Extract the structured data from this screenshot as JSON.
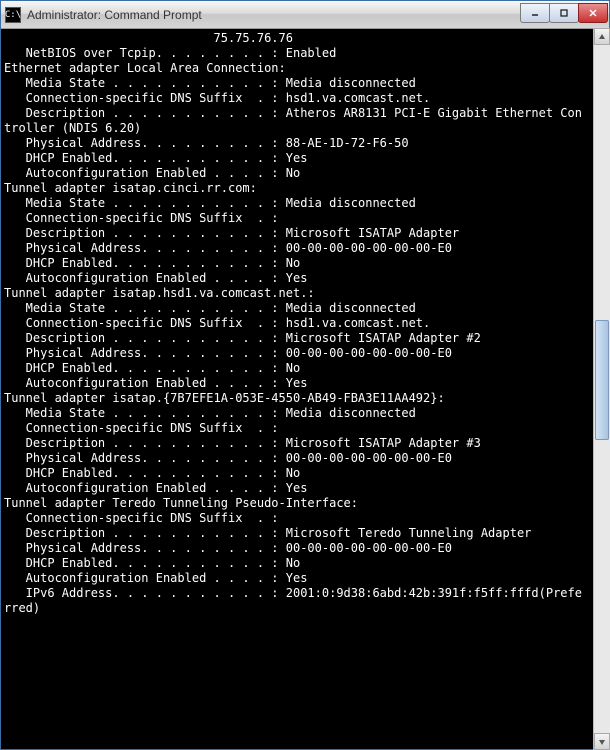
{
  "window": {
    "title": "Administrator: Command Prompt",
    "sysicon_label": "C:\\"
  },
  "lines": [
    "                             75.75.76.76",
    "   NetBIOS over Tcpip. . . . . . . . : Enabled",
    "",
    "Ethernet adapter Local Area Connection:",
    "",
    "   Media State . . . . . . . . . . . : Media disconnected",
    "   Connection-specific DNS Suffix  . : hsd1.va.comcast.net.",
    "   Description . . . . . . . . . . . : Atheros AR8131 PCI-E Gigabit Ethernet Con",
    "troller (NDIS 6.20)",
    "   Physical Address. . . . . . . . . : 88-AE-1D-72-F6-50",
    "   DHCP Enabled. . . . . . . . . . . : Yes",
    "   Autoconfiguration Enabled . . . . : No",
    "",
    "Tunnel adapter isatap.cinci.rr.com:",
    "",
    "   Media State . . . . . . . . . . . : Media disconnected",
    "   Connection-specific DNS Suffix  . :",
    "   Description . . . . . . . . . . . : Microsoft ISATAP Adapter",
    "   Physical Address. . . . . . . . . : 00-00-00-00-00-00-00-E0",
    "   DHCP Enabled. . . . . . . . . . . : No",
    "   Autoconfiguration Enabled . . . . : Yes",
    "",
    "Tunnel adapter isatap.hsd1.va.comcast.net.:",
    "",
    "   Media State . . . . . . . . . . . : Media disconnected",
    "   Connection-specific DNS Suffix  . : hsd1.va.comcast.net.",
    "   Description . . . . . . . . . . . : Microsoft ISATAP Adapter #2",
    "   Physical Address. . . . . . . . . : 00-00-00-00-00-00-00-E0",
    "   DHCP Enabled. . . . . . . . . . . : No",
    "   Autoconfiguration Enabled . . . . : Yes",
    "",
    "Tunnel adapter isatap.{7B7EFE1A-053E-4550-AB49-FBA3E11AA492}:",
    "",
    "   Media State . . . . . . . . . . . : Media disconnected",
    "   Connection-specific DNS Suffix  . :",
    "   Description . . . . . . . . . . . : Microsoft ISATAP Adapter #3",
    "   Physical Address. . . . . . . . . : 00-00-00-00-00-00-00-E0",
    "   DHCP Enabled. . . . . . . . . . . : No",
    "   Autoconfiguration Enabled . . . . : Yes",
    "",
    "Tunnel adapter Teredo Tunneling Pseudo-Interface:",
    "",
    "   Connection-specific DNS Suffix  . :",
    "   Description . . . . . . . . . . . : Microsoft Teredo Tunneling Adapter",
    "   Physical Address. . . . . . . . . : 00-00-00-00-00-00-00-E0",
    "   DHCP Enabled. . . . . . . . . . . : No",
    "   Autoconfiguration Enabled . . . . : Yes",
    "   IPv6 Address. . . . . . . . . . . : 2001:0:9d38:6abd:42b:391f:f5ff:fffd(Prefe",
    "rred)"
  ]
}
